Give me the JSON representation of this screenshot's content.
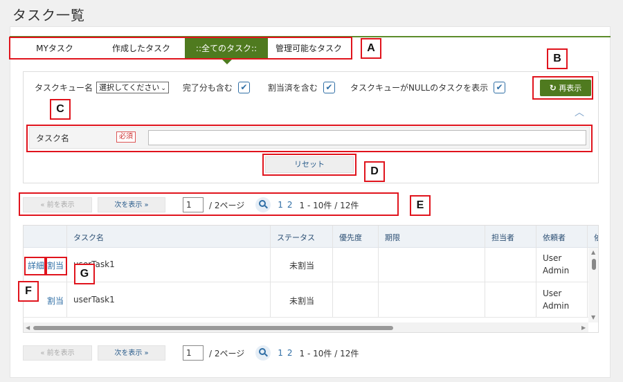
{
  "page": {
    "title": "タスク一覧"
  },
  "tabs": [
    {
      "label": "MYタスク"
    },
    {
      "label": "作成したタスク"
    },
    {
      "label": "::全てのタスク::",
      "active": true
    },
    {
      "label": "管理可能なタスク"
    }
  ],
  "filters": {
    "queue_label": "タスクキュー名",
    "queue_select": "選択してください",
    "include_done_label": "完了分も含む",
    "include_assigned_label": "割当済を含む",
    "show_null_queue_label": "タスクキューがNULLのタスクを表示",
    "checked": "✔",
    "refresh_icon": "refresh-icon",
    "refresh_label": "再表示",
    "task_name_label": "タスク名",
    "required_badge": "必須",
    "reset_label": "リセット"
  },
  "pager": {
    "prev_label": "« 前を表示",
    "next_label": "次を表示 »",
    "page_value": "1",
    "total_pages": "/ 2ページ",
    "page_links": [
      "1",
      "2"
    ],
    "range": "1 - 10件 / 12件"
  },
  "table": {
    "columns": [
      "タスク名",
      "ステータス",
      "優先度",
      "期限",
      "担当者",
      "依頼者",
      "依"
    ],
    "rows": [
      {
        "detail": "詳細",
        "assign": "割当",
        "task_name": "userTask1",
        "status": "未割当",
        "requester_line1": "User",
        "requester_line2": "Admin"
      },
      {
        "detail": "",
        "assign": "割当",
        "task_name": "userTask1",
        "status": "未割当",
        "requester_line1": "User",
        "requester_line2": "Admin"
      }
    ]
  },
  "annotations": [
    "A",
    "B",
    "C",
    "D",
    "E",
    "F",
    "G"
  ],
  "colors": {
    "accent_green": "#4f7a1f",
    "annotation_red": "#e0131c",
    "link_blue": "#2f6ea5"
  }
}
